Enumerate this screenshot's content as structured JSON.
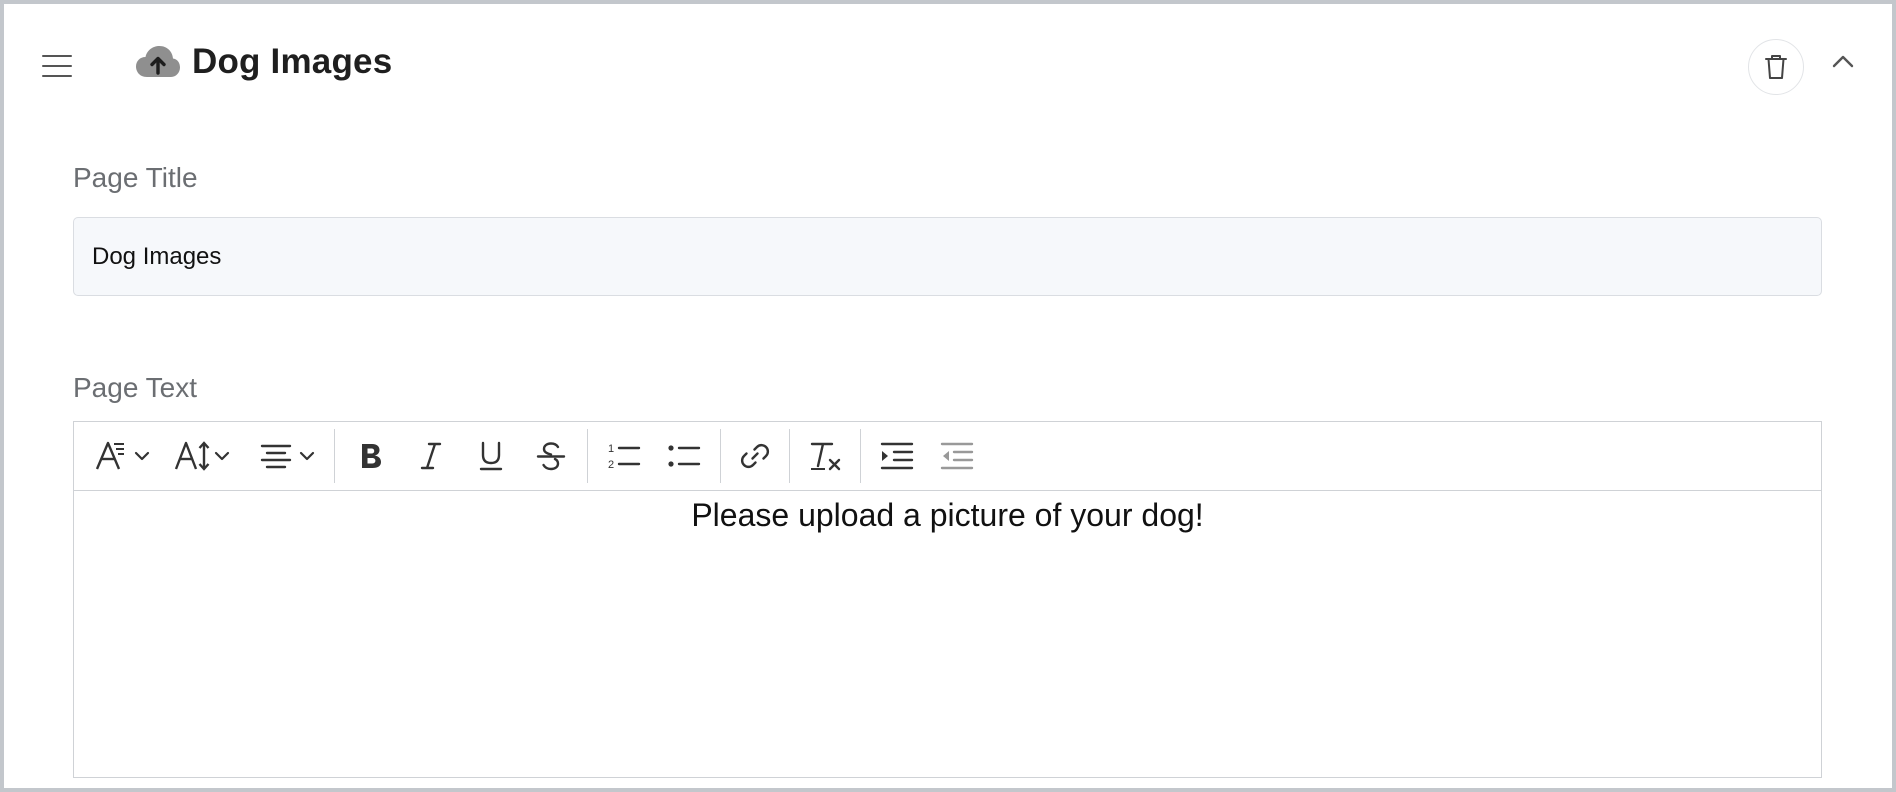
{
  "header": {
    "title": "Dog Images",
    "icons": {
      "menu": "hamburger-icon",
      "title": "cloud-upload-icon",
      "delete": "trash-icon",
      "collapse": "chevron-up-icon"
    }
  },
  "form": {
    "page_title": {
      "label": "Page Title",
      "value": "Dog Images"
    },
    "page_text": {
      "label": "Page Text",
      "content": "Please upload a picture of your dog!"
    }
  },
  "toolbar": {
    "items": [
      "font-style-icon",
      "font-size-icon",
      "text-align-icon",
      "bold-icon",
      "italic-icon",
      "underline-icon",
      "strikethrough-icon",
      "ordered-list-icon",
      "bullet-list-icon",
      "link-icon",
      "clear-format-icon",
      "indent-icon",
      "outdent-icon"
    ]
  },
  "colors": {
    "frame_border": "#c3c7cc",
    "label_gray": "#6b6e72",
    "input_bg": "#f6f8fb",
    "icon_gray": "#8a8a8a"
  }
}
